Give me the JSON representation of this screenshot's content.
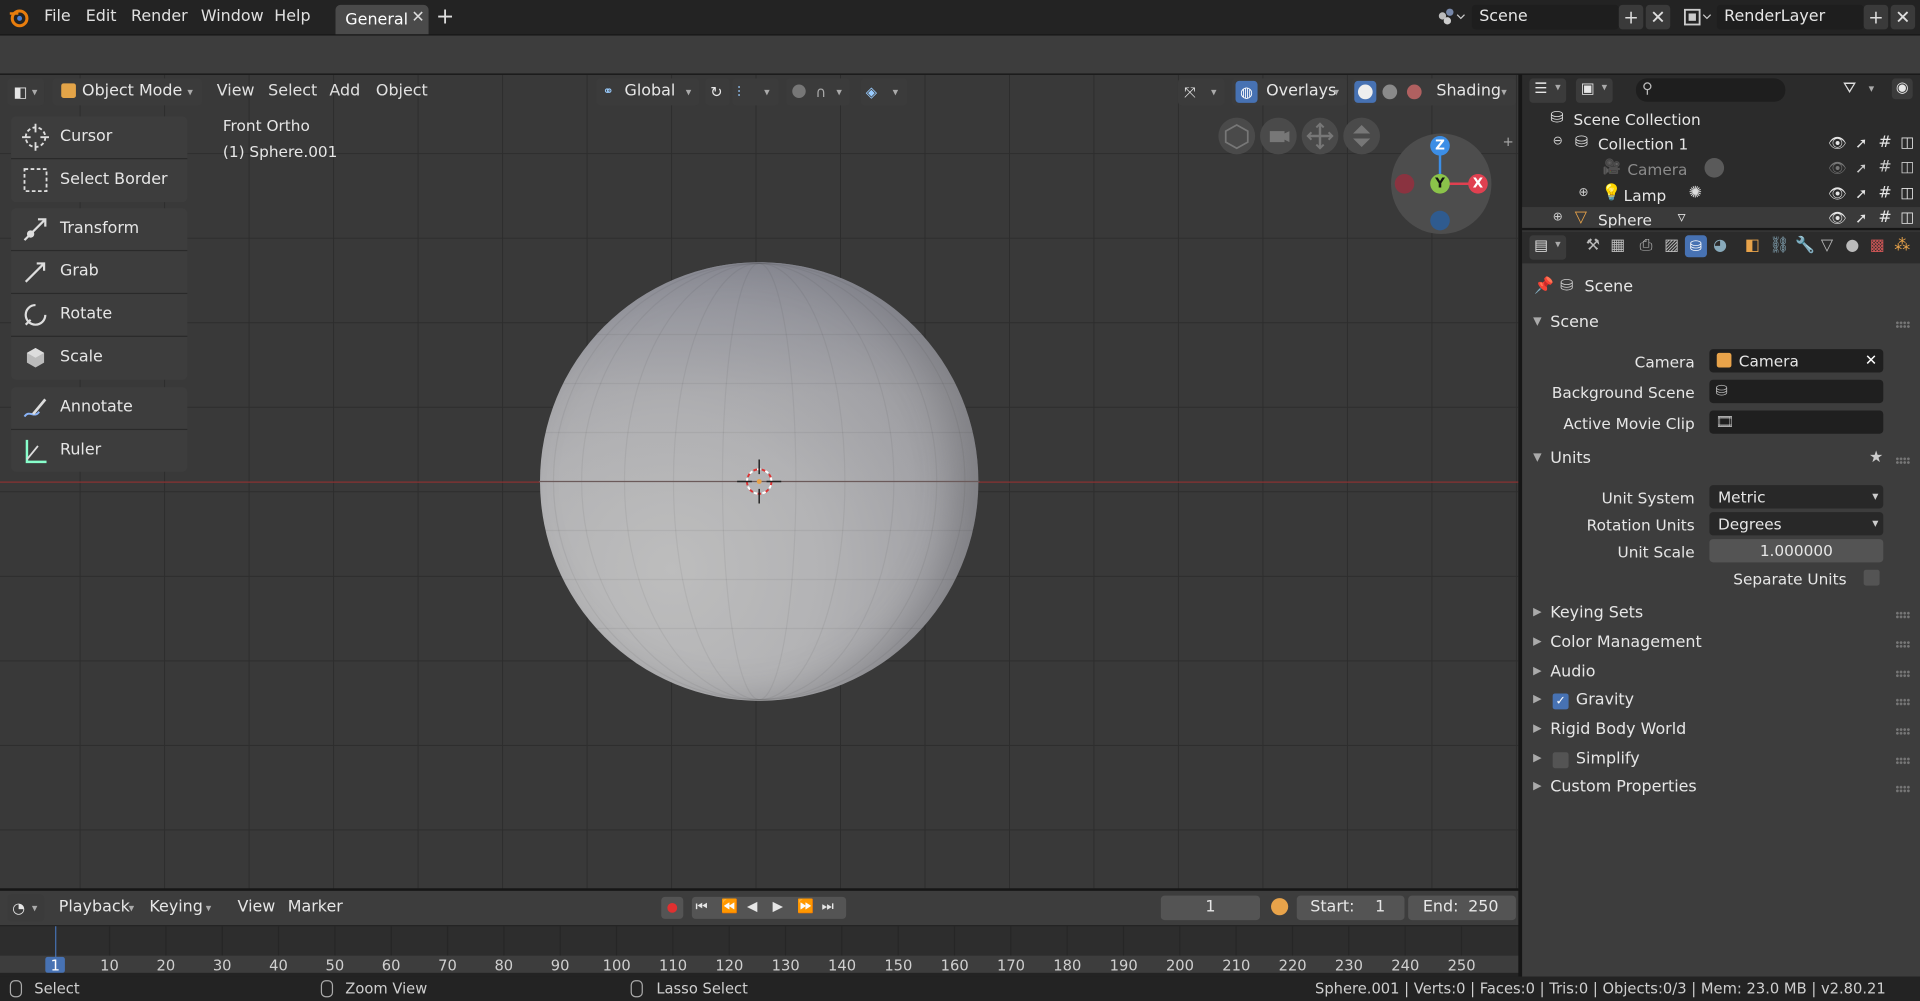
{
  "topbar": {
    "menus": [
      "File",
      "Edit",
      "Render",
      "Window",
      "Help"
    ],
    "workspace_tab": "General",
    "scene_name": "Scene",
    "render_layer": "RenderLayer"
  },
  "viewport": {
    "mode": "Object Mode",
    "menus": [
      "View",
      "Select",
      "Add",
      "Object"
    ],
    "orientation": "Global",
    "overlays_label": "Overlays",
    "shading_label": "Shading",
    "view_name": "Front Ortho",
    "active_object": "(1) Sphere.001",
    "gizmo_axes": {
      "z": "Z",
      "y": "Y",
      "x": "X"
    }
  },
  "toolbar": {
    "tools": [
      "Cursor",
      "Select Border",
      "Transform",
      "Grab",
      "Rotate",
      "Scale",
      "Annotate",
      "Ruler"
    ]
  },
  "timeline": {
    "menus": [
      "Playback",
      "Keying",
      "View",
      "Marker"
    ],
    "current_frame": "1",
    "start_label": "Start:",
    "start_value": "1",
    "end_label": "End:",
    "end_value": "250",
    "ruler_numbers": [
      "1",
      "10",
      "20",
      "30",
      "40",
      "50",
      "60",
      "70",
      "80",
      "90",
      "100",
      "110",
      "120",
      "130",
      "140",
      "150",
      "160",
      "170",
      "180",
      "190",
      "200",
      "210",
      "220",
      "230",
      "240",
      "250"
    ]
  },
  "statusbar": {
    "select": "Select",
    "zoom_view": "Zoom View",
    "lasso_select": "Lasso Select",
    "stats": "Sphere.001 | Verts:0 | Faces:0 | Tris:0 | Objects:0/3 | Mem: 23.0 MB | v2.80.21"
  },
  "outliner": {
    "scene_collection": "Scene Collection",
    "collection": "Collection 1",
    "items": [
      "Camera",
      "Lamp",
      "Sphere"
    ]
  },
  "properties": {
    "context": "Scene",
    "scene_panel": "Scene",
    "camera_label": "Camera",
    "camera_value": "Camera",
    "background_scene_label": "Background Scene",
    "active_movie_clip_label": "Active Movie Clip",
    "units_panel": "Units",
    "unit_system_label": "Unit System",
    "unit_system_value": "Metric",
    "rotation_units_label": "Rotation Units",
    "rotation_units_value": "Degrees",
    "unit_scale_label": "Unit Scale",
    "unit_scale_value": "1.000000",
    "separate_units_label": "Separate Units",
    "collapsed_panels": [
      "Keying Sets",
      "Color Management",
      "Audio",
      "Gravity",
      "Rigid Body World",
      "Simplify",
      "Custom Properties"
    ]
  },
  "colors": {
    "accent_blue": "#4772b3",
    "axis_x": "#e04050",
    "axis_y": "#8bc34a",
    "axis_z": "#3c8ee6"
  }
}
